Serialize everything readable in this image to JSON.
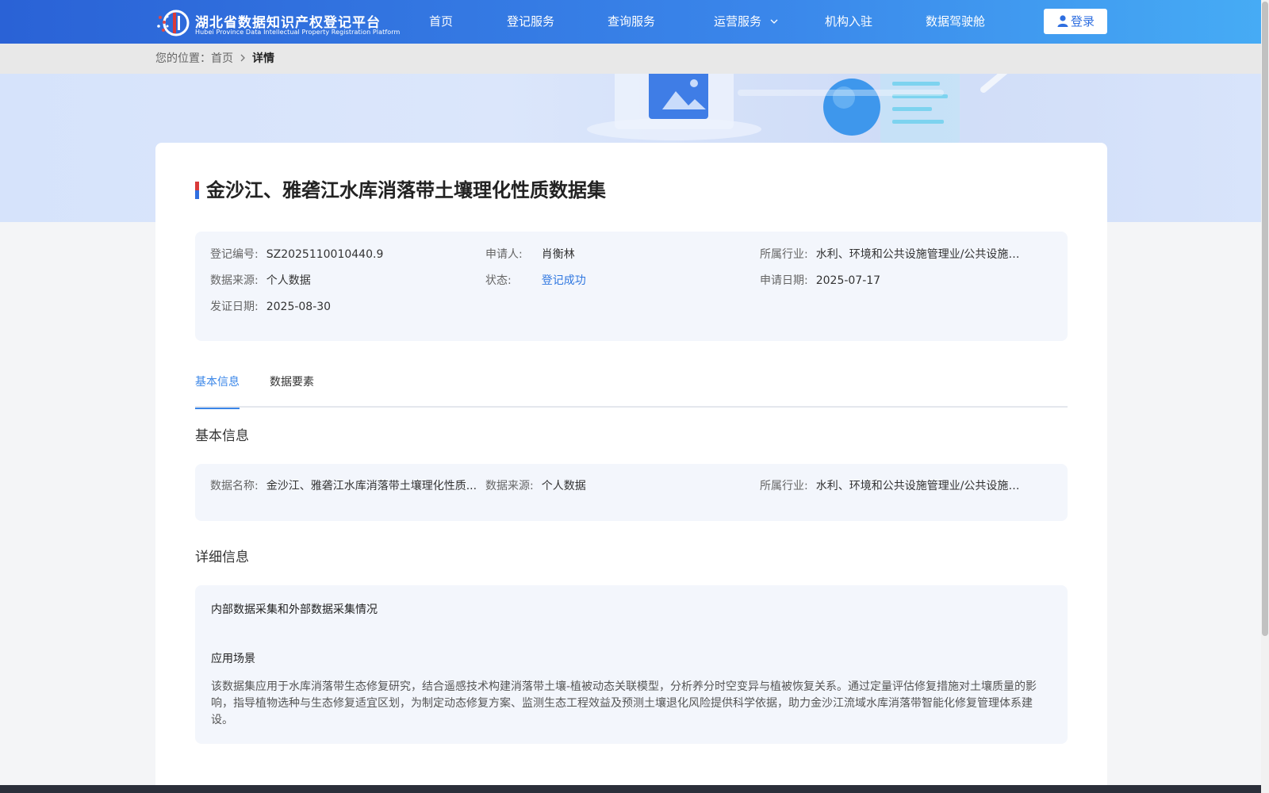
{
  "site": {
    "title": "湖北省数据知识产权登记平台",
    "subtitle": "Hubei Province Data Intellectual Property Registration Platform"
  },
  "nav": {
    "items": [
      "首页",
      "登记服务",
      "查询服务",
      "运营服务",
      "机构入驻",
      "数据驾驶舱"
    ],
    "login_label": "登录"
  },
  "breadcrumb": {
    "prefix": "您的位置：",
    "home": "首页",
    "current": "详情"
  },
  "record": {
    "title": "金沙江、雅砻江水库消落带土壤理化性质数据集",
    "fields": {
      "reg_no_label": "登记编号:",
      "reg_no": "SZ2025110010440.9",
      "applicant_label": "申请人:",
      "applicant": "肖衡林",
      "industry_label": "所属行业:",
      "industry": "水利、环境和公共设施管理业/公共设施管...",
      "source_label": "数据来源:",
      "source": "个人数据",
      "status_label": "状态:",
      "status": "登记成功",
      "apply_date_label": "申请日期:",
      "apply_date": "2025-07-17",
      "cert_date_label": "发证日期:",
      "cert_date": "2025-08-30"
    }
  },
  "tabs": [
    "基本信息",
    "数据要素"
  ],
  "basic": {
    "section_title": "基本信息",
    "name_label": "数据名称:",
    "name": "金沙江、雅砻江水库消落带土壤理化性质...",
    "source_label": "数据来源:",
    "source": "个人数据",
    "industry_label": "所属行业:",
    "industry": "水利、环境和公共设施管理业/公共设施管..."
  },
  "detail": {
    "section_title": "详细信息",
    "collection_heading": "内部数据采集和外部数据采集情况",
    "scenario_heading": "应用场景",
    "scenario_text": "该数据集应用于水库消落带生态修复研究，结合遥感技术构建消落带土壤-植被动态关联模型，分析养分时空变异与植被恢复关系。通过定量评估修复措施对土壤质量的影响，指导植物选种与生态修复适宜区划，为制定动态修复方案、监测生态工程效益及预测土壤退化风险提供科学依据，助力金沙江流域水库消落带智能化修复管理体系建设。"
  },
  "icons": {
    "logo": "platform-logo-icon",
    "nav_dropdown": "chevron-down-icon",
    "login": "user-icon",
    "breadcrumb_sep": "chevron-right-icon",
    "banner_illustration": "data-illustration-icon",
    "title_mark": "title-flag-icon"
  },
  "colors": {
    "header_start": "#2a62d6",
    "header_end": "#46acf5",
    "accent": "#3a86e8",
    "status_success": "#2f77e0",
    "panel_bg": "#f3f6fc"
  }
}
